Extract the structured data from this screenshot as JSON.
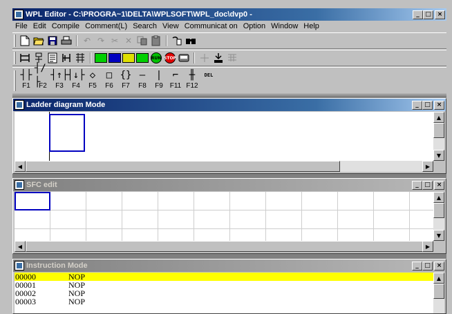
{
  "window": {
    "title": "WPL Editor  -  C:\\PROGRA~1\\DELTA\\WPLSOFT\\WPL_doc\\dvp0 -"
  },
  "window_buttons": {
    "minimize": "_",
    "maximize": "□",
    "close": "×"
  },
  "menu": [
    "File",
    "Edit",
    "Compile",
    "Comment(L)",
    "Search",
    "View",
    "Communicat on",
    "Option",
    "Window",
    "Help"
  ],
  "toolbar3": {
    "keys": [
      {
        "symbol": "┤├",
        "label": "F1"
      },
      {
        "symbol": "┤/├",
        "label": "F2"
      },
      {
        "symbol": "┤↑├",
        "label": "F3"
      },
      {
        "symbol": "┤↓├",
        "label": "F4"
      },
      {
        "symbol": "◇",
        "label": "F5"
      },
      {
        "symbol": "□",
        "label": "F6"
      },
      {
        "symbol": "{}",
        "label": "F7"
      },
      {
        "symbol": "—",
        "label": "F8"
      },
      {
        "symbol": "|",
        "label": "F9"
      },
      {
        "symbol": "⌐",
        "label": "F11"
      },
      {
        "symbol": "╫",
        "label": "F12"
      }
    ],
    "del_label": "DEL"
  },
  "toolbar2": {
    "chips": [
      "RUN",
      "STOP"
    ]
  },
  "ladder": {
    "title": "Ladder diagram Mode"
  },
  "sfc": {
    "title": "SFC edit"
  },
  "instruction": {
    "title": "Instruction Mode",
    "rows": [
      {
        "addr": "00000",
        "op": "NOP"
      },
      {
        "addr": "00001",
        "op": "NOP"
      },
      {
        "addr": "00002",
        "op": "NOP"
      },
      {
        "addr": "00003",
        "op": "NOP"
      }
    ]
  },
  "colors": {
    "title_active": "#0a246a",
    "selection_row": "#ffff00",
    "cursor": "#0000c0"
  }
}
